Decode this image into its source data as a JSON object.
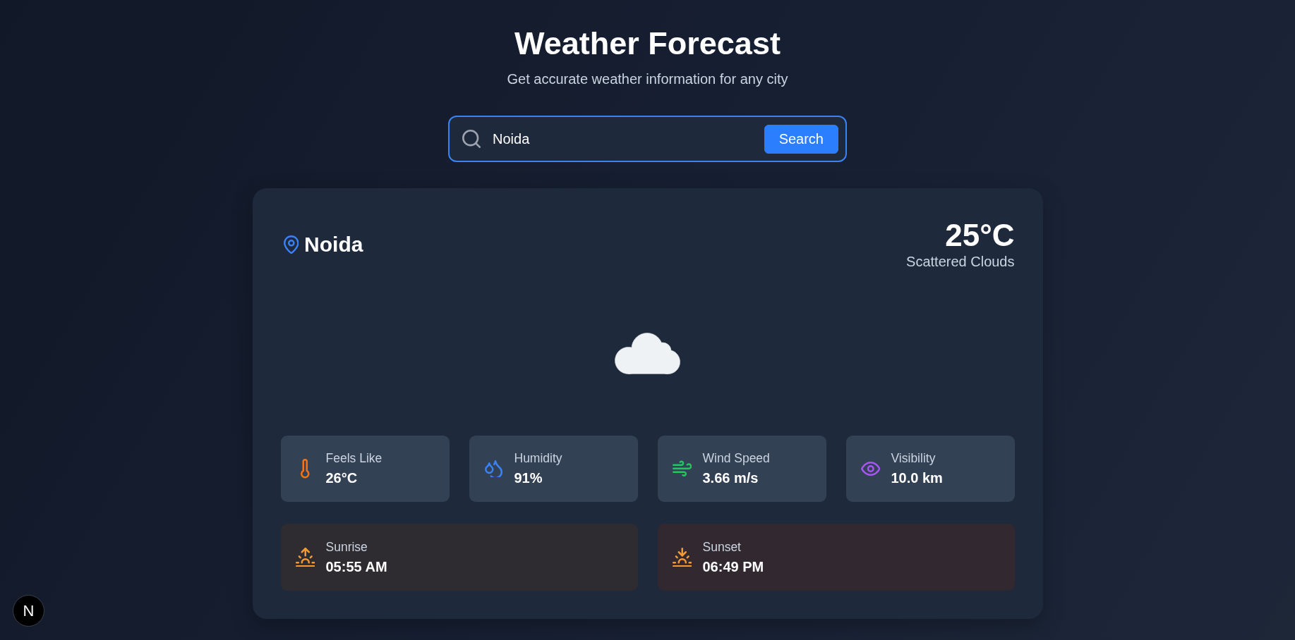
{
  "header": {
    "title": "Weather Forecast",
    "subtitle": "Get accurate weather information for any city"
  },
  "search": {
    "value": "Noida",
    "focused": true,
    "button": "Search"
  },
  "current": {
    "city": "Noida",
    "temperature": "25°C",
    "description": "Scattered Clouds"
  },
  "stats": [
    {
      "kind": "temperature",
      "label": "Feels Like",
      "value": "26°C"
    },
    {
      "kind": "humidity",
      "label": "Humidity",
      "value": "91%"
    },
    {
      "kind": "wind",
      "label": "Wind Speed",
      "value": "3.66 m/s"
    },
    {
      "kind": "visibility",
      "label": "Visibility",
      "value": "10.0 km"
    }
  ],
  "sun_times": [
    {
      "kind": "sunrise",
      "label": "Sunrise",
      "value": "05:55 AM"
    },
    {
      "kind": "sunset",
      "label": "Sunset",
      "value": "06:49 PM"
    }
  ],
  "dev_badge": {
    "letter": "N"
  }
}
